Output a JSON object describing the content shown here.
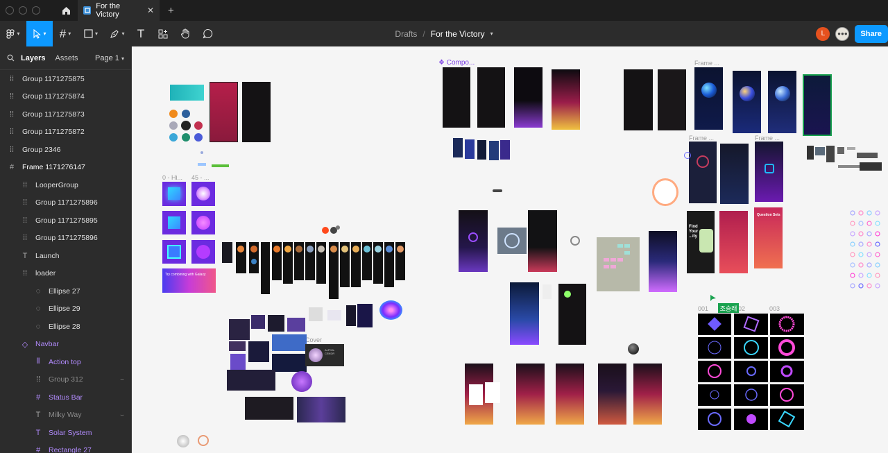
{
  "tabbar": {
    "file_tab_title": "For the Victory",
    "new_tab_symbol": "+",
    "close_symbol": "✕"
  },
  "toolbar": {
    "breadcrumb_parent": "Drafts",
    "breadcrumb_separator": "/",
    "file_name": "For the Victory",
    "share_label": "Share",
    "avatars": [
      {
        "initial": "L",
        "color": "#e5511e"
      },
      {
        "initial": "",
        "color": "#e9e5dc"
      }
    ]
  },
  "panel": {
    "tabs": [
      "Layers",
      "Assets"
    ],
    "page_label": "Page 1"
  },
  "layers": [
    {
      "name": "Group 1171275875",
      "icon": "group-icon",
      "indent": 0,
      "style": "normal"
    },
    {
      "name": "Group 1171275874",
      "icon": "group-icon",
      "indent": 0,
      "style": "normal"
    },
    {
      "name": "Group 1171275873",
      "icon": "group-icon",
      "indent": 0,
      "style": "normal"
    },
    {
      "name": "Group 1171275872",
      "icon": "group-icon",
      "indent": 0,
      "style": "normal"
    },
    {
      "name": "Group 2346",
      "icon": "group-icon",
      "indent": 0,
      "style": "normal"
    },
    {
      "name": "Frame 1171276147",
      "icon": "frame-icon",
      "indent": 0,
      "style": "strong"
    },
    {
      "name": "LooperGroup",
      "icon": "group-icon",
      "indent": 1,
      "style": "normal"
    },
    {
      "name": "Group 1171275896",
      "icon": "group-icon",
      "indent": 1,
      "style": "normal"
    },
    {
      "name": "Group 1171275895",
      "icon": "group-icon",
      "indent": 1,
      "style": "normal"
    },
    {
      "name": "Group 1171275896",
      "icon": "group-icon",
      "indent": 1,
      "style": "normal"
    },
    {
      "name": "Launch",
      "icon": "text-icon",
      "indent": 1,
      "style": "normal"
    },
    {
      "name": "loader",
      "icon": "group-icon",
      "indent": 1,
      "style": "normal"
    },
    {
      "name": "Ellipse 27",
      "icon": "ellipse-icon",
      "indent": 2,
      "style": "normal"
    },
    {
      "name": "Ellipse 29",
      "icon": "ellipse-icon",
      "indent": 2,
      "style": "normal"
    },
    {
      "name": "Ellipse 28",
      "icon": "ellipse-icon",
      "indent": 2,
      "style": "normal"
    },
    {
      "name": "Navbar",
      "icon": "component-icon",
      "indent": 1,
      "style": "purple"
    },
    {
      "name": "Action top",
      "icon": "instance-icon",
      "indent": 2,
      "style": "purple"
    },
    {
      "name": "Group 312",
      "icon": "group-icon",
      "indent": 2,
      "style": "dim",
      "hidden": true
    },
    {
      "name": "Status Bar",
      "icon": "frame-icon",
      "indent": 2,
      "style": "purple"
    },
    {
      "name": "Milky Way",
      "icon": "text-icon",
      "indent": 2,
      "style": "dim",
      "hidden": true
    },
    {
      "name": "Solar System",
      "icon": "text-icon",
      "indent": 2,
      "style": "purple"
    },
    {
      "name": "Rectangle 27",
      "icon": "frame-icon",
      "indent": 2,
      "style": "purple"
    }
  ],
  "canvas": {
    "labels": {
      "components": "❖ Compo...",
      "frame_top": "Frame ...",
      "frame_a": "Frame ...",
      "frame_b": "Frame ...",
      "hi_0": "0 - Hi...",
      "hi_45": "45 - ...",
      "cover": "Cover",
      "n001": "001",
      "n002": "02",
      "n003": "003",
      "cursor_name": "조승래"
    },
    "snippets": {
      "dark_card_title": "Find Your ...ity",
      "purple_card_text": "Try combining with Galaxy",
      "question_sets": "Question Sets",
      "cover_card": "ALPHA-CENDR"
    }
  },
  "colors": {
    "accent": "#0d99ff",
    "component_purple": "#b38cff",
    "cursor_green": "#1aa24f"
  }
}
